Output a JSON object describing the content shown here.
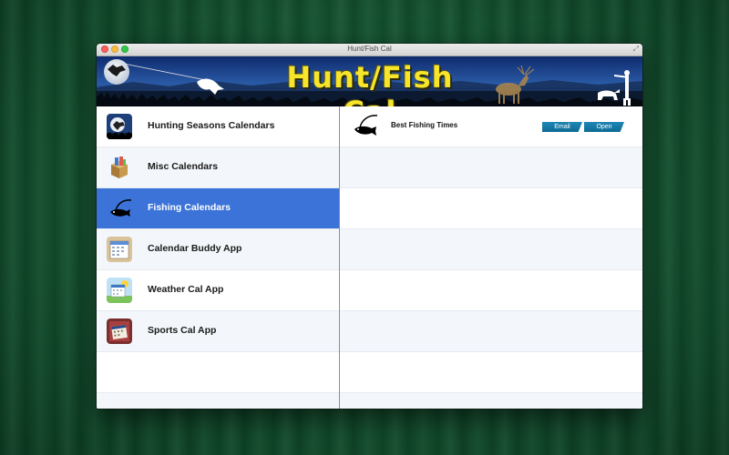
{
  "window": {
    "title": "Hunt/Fish Cal"
  },
  "banner": {
    "title": "Hunt/Fish Cal"
  },
  "menu": {
    "items": [
      {
        "label": "Hunting Seasons Calendars",
        "icon": "moon-hunter-icon"
      },
      {
        "label": "Misc Calendars",
        "icon": "box-icon"
      },
      {
        "label": "Fishing Calendars",
        "icon": "fish-hook-icon",
        "selected": true
      },
      {
        "label": "Calendar Buddy App",
        "icon": "calendar-icon"
      },
      {
        "label": "Weather Cal App",
        "icon": "weather-calendar-icon"
      },
      {
        "label": "Sports Cal App",
        "icon": "sports-calendar-icon"
      }
    ]
  },
  "detail": {
    "items": [
      {
        "label": "Best Fishing Times",
        "icon": "fish-hook-icon",
        "email_label": "Email",
        "open_label": "Open"
      }
    ]
  },
  "colors": {
    "selection": "#3b73d8",
    "button": "#1f88b6",
    "banner_text": "#f6e52a",
    "desktop": "#145632"
  }
}
